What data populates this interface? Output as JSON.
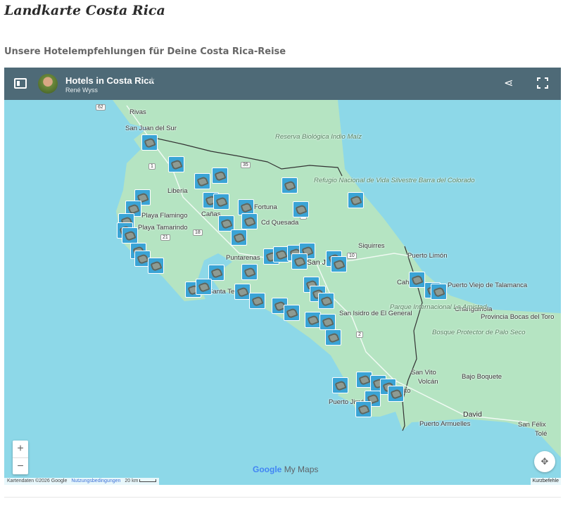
{
  "page": {
    "title": "Landkarte Costa Rica",
    "subtitle": "Unsere Hotelempfehlungen für Deine Costa Rica-Reise"
  },
  "map": {
    "title": "Hotels in Costa Rica",
    "author": "René Wyss",
    "places": [
      "Rivas",
      "San Juan del Sur",
      "Liberia",
      "Cañas",
      "Fortuna",
      "Cd Quesada",
      "Puntarenas",
      "San José",
      "Siquirres",
      "Puerto Limón",
      "Cahuita",
      "Puerto Viejo de Talamanca",
      "Changuinola",
      "Provincia Bocas del Toro",
      "San Isidro de El General",
      "Parque Internacional La Amistad",
      "Bosque Protector de Palo Seco",
      "San Vito",
      "Volcán",
      "Bajo Boquete",
      "David",
      "Puerto Armuelles",
      "San Félix",
      "Tolé",
      "Puerto Jiménez",
      "Golfito",
      "Playa Tamarindo",
      "Playa Flamingo",
      "Santa Teresa",
      "Reserva Biológica Indio Maíz",
      "Refugio Nacional de Vida Silvestre Barra del Colorado"
    ],
    "roads": [
      "62",
      "1",
      "35",
      "18",
      "21",
      "10",
      "2",
      "4"
    ],
    "zoom_in": "+",
    "zoom_out": "−",
    "logo_google": "Google",
    "logo_mymaps": "My Maps",
    "attribution": "Kartendaten ©2026 Google",
    "terms": "Nutzungsbedingungen",
    "scale": "20 km",
    "shortcuts": "Kurzbefehle",
    "marker_count": 52,
    "colors": {
      "header": "#4e6a77",
      "water": "#8dd8e8",
      "land": "#b5e4c2",
      "marker": "#3aa4d6"
    }
  }
}
